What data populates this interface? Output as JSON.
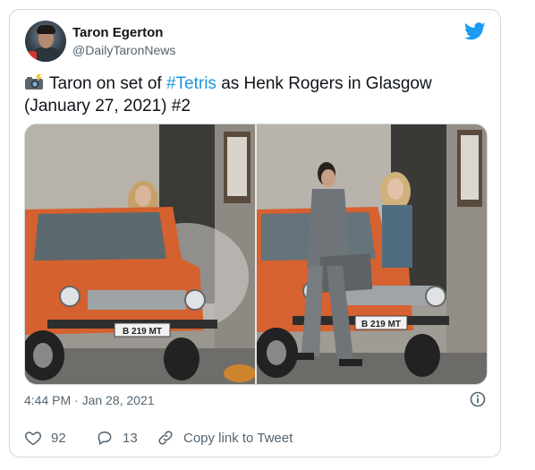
{
  "author": {
    "name": "Taron Egerton",
    "handle": "@DailyTaronNews",
    "avatar_icon": "profile-photo"
  },
  "brand": {
    "icon": "twitter-bird-icon",
    "color": "#1d9bf0"
  },
  "tweet": {
    "emoji_icon": "camera-with-flash-icon",
    "text_before": "Taron on set of ",
    "hashtag": "#Tetris",
    "text_after": " as Henk Rogers in Glasgow (January 27, 2021) #2",
    "hashtag_color": "#1b95e0"
  },
  "media": {
    "photos": [
      {
        "plate": "B 219 MT"
      },
      {
        "plate": "B 219 MT"
      }
    ]
  },
  "meta": {
    "timestamp": "4:44 PM · Jan 28, 2021",
    "info_icon": "info-icon"
  },
  "actions": {
    "like_count": "92",
    "reply_count": "13",
    "copy_link_label": "Copy link to Tweet"
  }
}
